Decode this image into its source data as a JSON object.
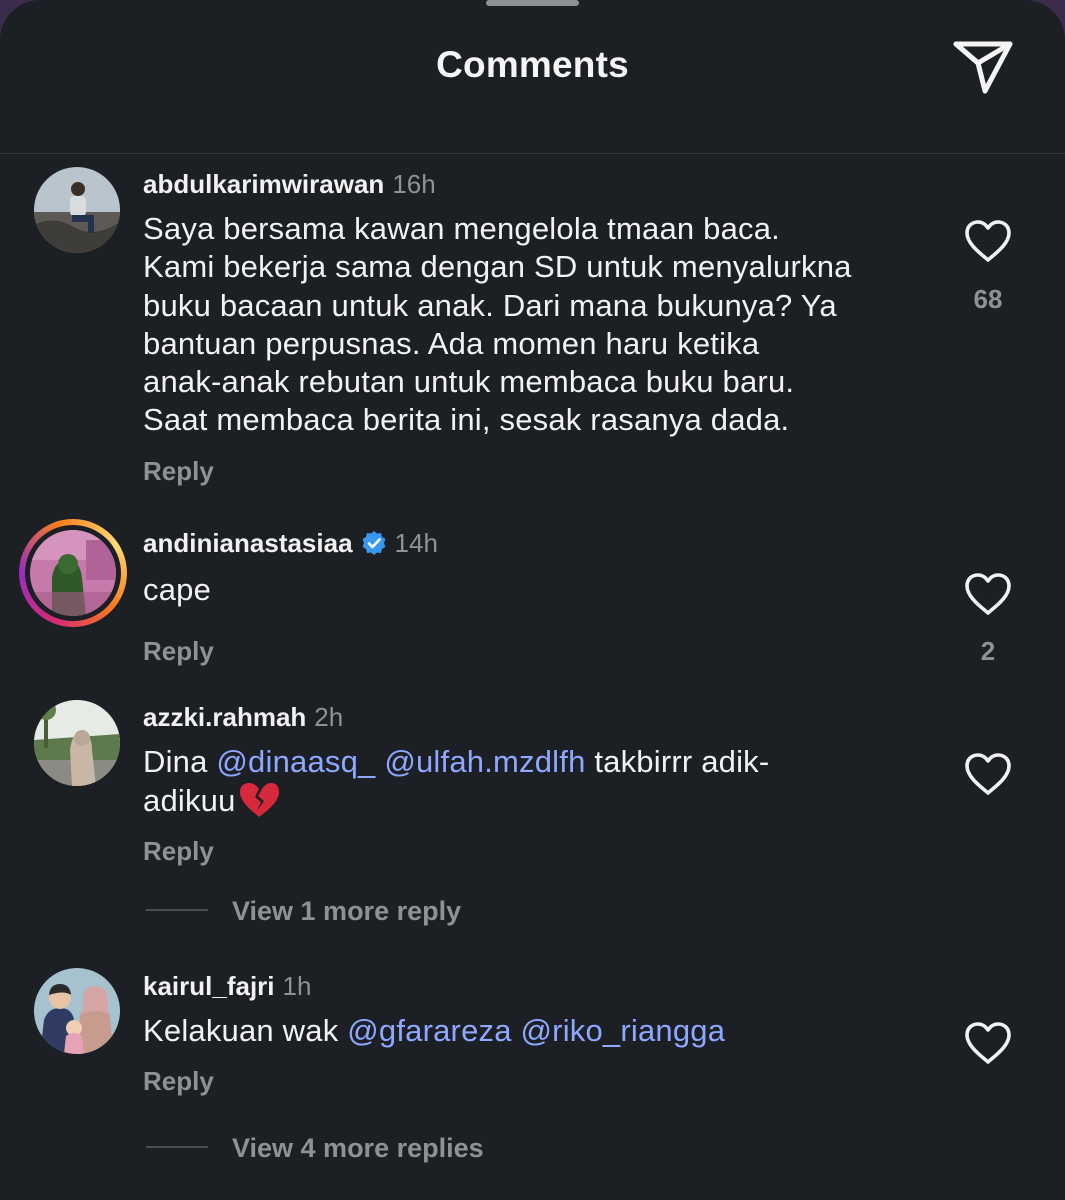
{
  "header": {
    "title": "Comments",
    "share_icon": "paper-plane-icon"
  },
  "colors": {
    "background": "#1c1f24",
    "text": "#f2f2f2",
    "muted": "#8e9196",
    "mention": "#8fa8ff",
    "verified": "#3897f0"
  },
  "comments": [
    {
      "username": "abdulkarimwirawan",
      "time": "16h",
      "verified": false,
      "text_lines": [
        "Saya bersama kawan mengelola tmaan baca.",
        "Kami bekerja sama dengan SD untuk menyalurkna",
        "buku bacaan untuk anak. Dari mana bukunya? Ya",
        "bantuan perpusnas. Ada momen haru ketika",
        "anak-anak rebutan untuk membaca buku baru.",
        "Saat membaca berita ini, sesak rasanya dada."
      ],
      "reply_label": "Reply",
      "likes": "68"
    },
    {
      "username": "andinianastasiaa",
      "time": "14h",
      "verified": true,
      "has_story": true,
      "text": "cape",
      "reply_label": "Reply",
      "likes": "2"
    },
    {
      "username": "azzki.rahmah",
      "time": "2h",
      "verified": false,
      "text_prefix": "Dina ",
      "mentions": [
        "@dinaasq_",
        "@ulfah.mzdlfh"
      ],
      "text_suffix_line1": " takbirrr adik-",
      "text_line2": "adikuu",
      "emoji": "broken-heart-icon",
      "reply_label": "Reply",
      "likes": "",
      "view_more": "View 1 more reply"
    },
    {
      "username": "kairul_fajri",
      "time": "1h",
      "verified": false,
      "text_prefix": "Kelakuan wak ",
      "mentions": [
        "@gfarareza",
        "@riko_riangga"
      ],
      "reply_label": "Reply",
      "likes": "",
      "view_more": "View 4 more replies"
    }
  ]
}
